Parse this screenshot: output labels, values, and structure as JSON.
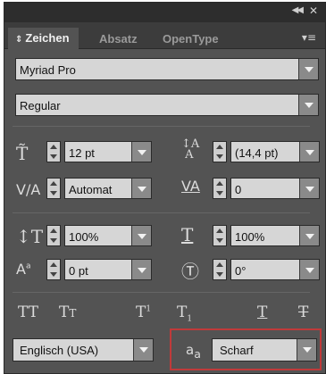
{
  "titlebar": {
    "collapse_icon": "double-chevron",
    "close_icon": "close"
  },
  "tabs": [
    {
      "label": "Zeichen",
      "active": true
    },
    {
      "label": "Absatz",
      "active": false
    },
    {
      "label": "OpenType",
      "active": false
    }
  ],
  "font": {
    "family": "Myriad Pro",
    "style": "Regular"
  },
  "controls": {
    "font_size": "12 pt",
    "leading": "(14,4 pt)",
    "kerning": "Automat",
    "tracking": "0",
    "vertical_scale": "100%",
    "horizontal_scale": "100%",
    "baseline_shift": "0 pt",
    "rotation": "0°"
  },
  "language": "Englisch (USA)",
  "antialiasing": "Scharf",
  "colors": {
    "panel": "#535353",
    "field": "#d6d6d6",
    "highlight": "#c03a3a"
  }
}
